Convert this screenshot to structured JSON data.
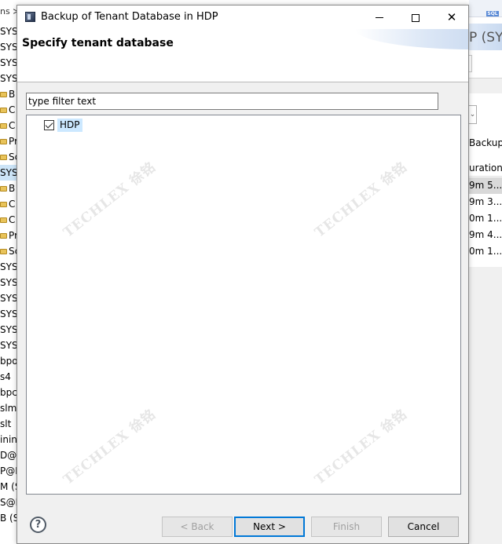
{
  "background_app": {
    "tree_header": "ns ≫",
    "tree_rows": [
      {
        "text": "SYST",
        "icon": ""
      },
      {
        "text": "SYST",
        "icon": ""
      },
      {
        "text": "SYST",
        "icon": ""
      },
      {
        "text": "SYST",
        "icon": ""
      },
      {
        "text": "B",
        "icon": "backup-icon"
      },
      {
        "text": "C",
        "icon": "folder-icon"
      },
      {
        "text": "C",
        "icon": "folder-icon"
      },
      {
        "text": "Pr",
        "icon": "folder-icon"
      },
      {
        "text": "Sc",
        "icon": "folder-icon"
      },
      {
        "text": "SYST",
        "icon": "",
        "selected": true
      },
      {
        "text": "B",
        "icon": "backup-icon"
      },
      {
        "text": "C",
        "icon": "folder-icon"
      },
      {
        "text": "C",
        "icon": "folder-icon"
      },
      {
        "text": "Pr",
        "icon": "folder-icon"
      },
      {
        "text": "Sc",
        "icon": "folder-icon"
      },
      {
        "text": "SYST",
        "icon": ""
      },
      {
        "text": "SYST",
        "icon": ""
      },
      {
        "text": "SYST",
        "icon": ""
      },
      {
        "text": "SYST",
        "icon": ""
      },
      {
        "text": "SYST",
        "icon": ""
      },
      {
        "text": "SYST",
        "icon": ""
      },
      {
        "text": "bpo",
        "icon": ""
      },
      {
        "text": "s4",
        "icon": ""
      },
      {
        "text": "bpc",
        "icon": ""
      },
      {
        "text": "slm",
        "icon": ""
      },
      {
        "text": "slt",
        "icon": ""
      },
      {
        "text": "ining",
        "icon": ""
      },
      {
        "text": "D@H",
        "icon": ""
      },
      {
        "text": "P@H",
        "icon": ""
      },
      {
        "text": "M (S",
        "icon": ""
      },
      {
        "text": "S@H",
        "icon": ""
      },
      {
        "text": "B (S",
        "icon": ""
      }
    ],
    "right_title": "P (SY",
    "right_sql_badge": "SQL",
    "right_section": "Backup",
    "right_column_header": "uration",
    "right_rows": [
      {
        "text": "9m 5...",
        "selected": true
      },
      {
        "text": "9m 3..."
      },
      {
        "text": "0m 1..."
      },
      {
        "text": "9m 4..."
      },
      {
        "text": "0m 1..."
      }
    ]
  },
  "dialog": {
    "title": "Backup of Tenant Database in HDP",
    "window_controls": {
      "minimize": "minimize",
      "maximize": "maximize",
      "close": "✕"
    },
    "header_title": "Specify tenant database",
    "filter": {
      "placeholder": "type filter text",
      "value": ""
    },
    "tree_items": [
      {
        "label": "HDP",
        "checked": true
      }
    ],
    "watermark_text": "TECHLEX 徐铭",
    "help_symbol": "?",
    "buttons": {
      "back": "< Back",
      "next": "Next >",
      "finish": "Finish",
      "cancel": "Cancel"
    },
    "button_states": {
      "back_enabled": false,
      "next_enabled": true,
      "finish_enabled": false,
      "cancel_enabled": true
    }
  }
}
